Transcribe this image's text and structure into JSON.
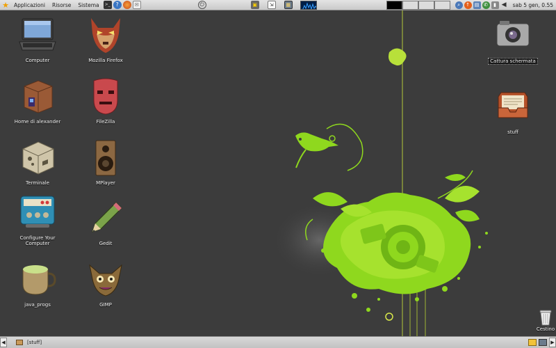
{
  "top_panel": {
    "menus": [
      "Applicazioni",
      "Risorse",
      "Sistema"
    ],
    "clock": "sab  5 gen,  0.55"
  },
  "desktop": {
    "left_icons": [
      {
        "label": "Computer",
        "icon": "laptop-icon"
      },
      {
        "label": "Mozilla Firefox",
        "icon": "fox-mask-icon"
      },
      {
        "label": "Home di alexander",
        "icon": "home-box-icon"
      },
      {
        "label": "FileZilla",
        "icon": "red-mask-icon"
      },
      {
        "label": "Terminale",
        "icon": "terminal-box-icon"
      },
      {
        "label": "MPlayer",
        "icon": "speaker-icon"
      },
      {
        "label": "Configure Your Computer",
        "icon": "config-screen-icon"
      },
      {
        "label": "Gedit",
        "icon": "pencil-icon"
      },
      {
        "label": "java_progs",
        "icon": "tea-cup-icon"
      },
      {
        "label": "GIMP",
        "icon": "gimp-creature-icon"
      }
    ],
    "right_icons": [
      {
        "label": "Cattura schermata",
        "icon": "camera-icon"
      },
      {
        "label": "stuff",
        "icon": "inbox-tray-icon"
      }
    ],
    "trash": {
      "label": "Cestino",
      "icon": "trash-can-icon"
    }
  },
  "bottom_panel": {
    "task": "[stuff]"
  },
  "colors": {
    "wallpaper": "#3c3c3c",
    "accent_green": "#8fd81e",
    "panel": "#d4d4d4"
  }
}
